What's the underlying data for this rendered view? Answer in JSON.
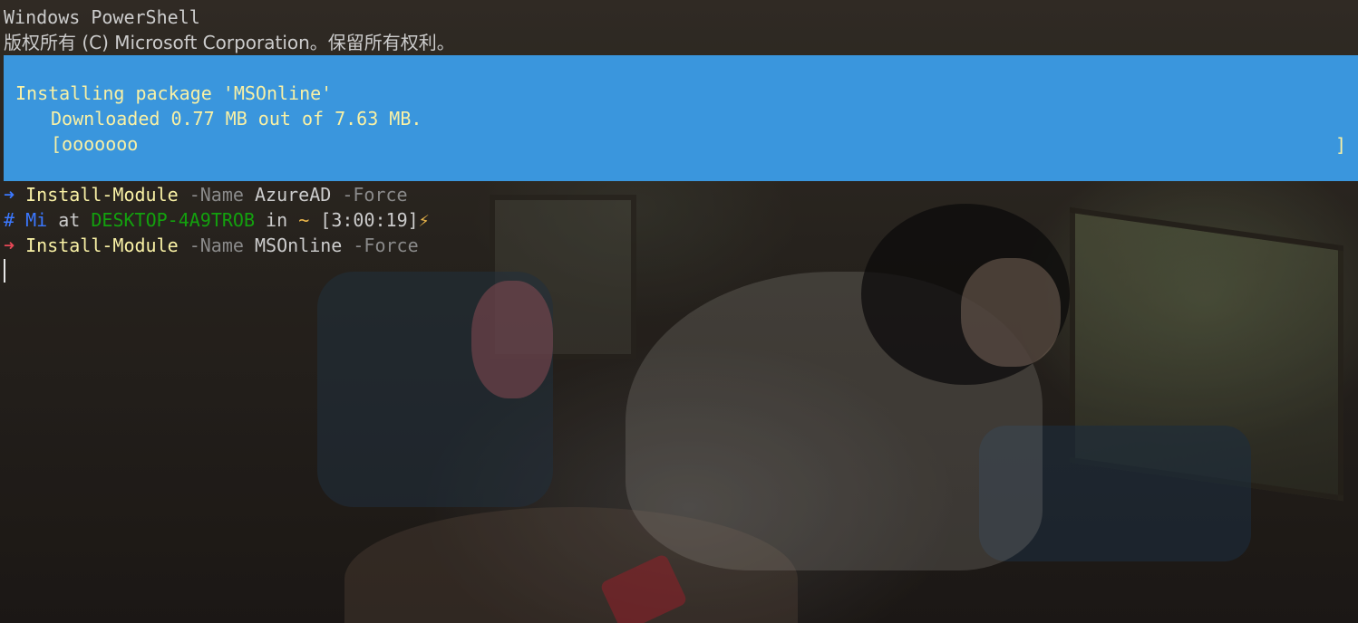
{
  "header": {
    "title": "Windows PowerShell",
    "copyright": "版权所有 (C) Microsoft Corporation。保留所有权利。"
  },
  "progress": {
    "activity": "Installing package 'MSOnline'",
    "status": "Downloaded 0.77 MB out of 7.63 MB.",
    "bar_open": "[",
    "bar_fill": "ooooooo",
    "bar_close": "]",
    "downloaded_mb": 0.77,
    "total_mb": 7.63
  },
  "history": {
    "cmd1": {
      "arrow": "➜",
      "command": "Install-Module",
      "param1": "-Name",
      "value1": "AzureAD",
      "param2": "-Force"
    },
    "prompt": {
      "hash": "#",
      "user": "Mi",
      "at": "at",
      "host": "DESKTOP-4A9TROB",
      "in": "in",
      "path": "~",
      "time": "[3:00:19]",
      "bolt": "⚡"
    },
    "cmd2": {
      "arrow": "➜",
      "command": "Install-Module",
      "param1": "-Name",
      "value1": "MSOnline",
      "param2": "-Force"
    }
  },
  "colors": {
    "progress_bg": "#3a96dd",
    "progress_fg": "#f9f1a5",
    "command": "#f9f1a5",
    "parameter": "#8a8a8a",
    "user": "#3b78ff",
    "host": "#13a10e",
    "path": "#e8b44a",
    "error_arrow": "#e74856"
  }
}
